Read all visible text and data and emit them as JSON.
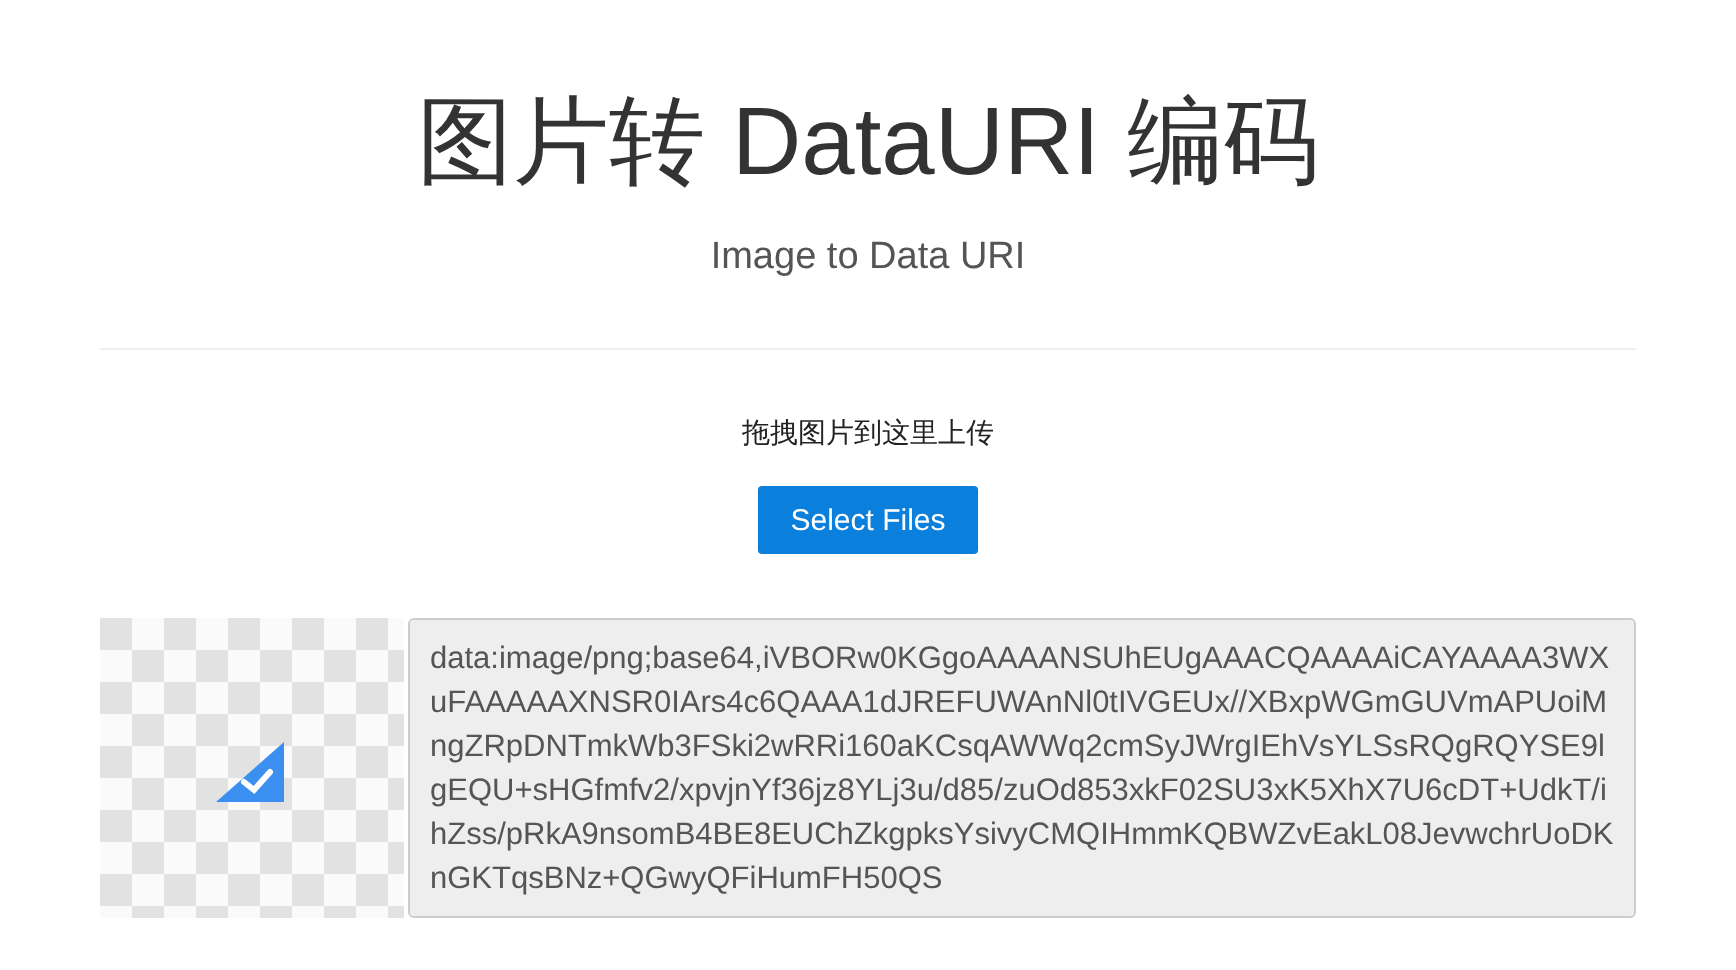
{
  "header": {
    "title": "图片转 DataURI 编码",
    "subtitle": "Image to Data URI"
  },
  "upload": {
    "hint": "拖拽图片到这里上传",
    "button": "Select Files"
  },
  "output": {
    "value": "data:image/png;base64,iVBORw0KGgoAAAANSUhEUgAAACQAAAAiCAYAAAA3WXuFAAAAAXNSR0IArs4c6QAAA1dJREFUWAnNl0tIVGEUx//XBxpWGmGUVmAPUoiMngZRpDNTmkWb3FSki2wRRi160aKCsqAWWq2cmSyJWrgIEhVsYLSsRQgRQYSE9lgEQU+sHGfmfv2/xpvjnYf36jz8YLj3u/d85/zuOd853xkF02SU3xK5XhX7U6cDT+UdkT/ihZss/pRkA9nsomB4BE8EUChZkgpksYsivyCMQIHmmKQBWZvEakL08JevwchrUoDKnGKTqsBNz+QGwyQFiHumFH50QS"
  }
}
